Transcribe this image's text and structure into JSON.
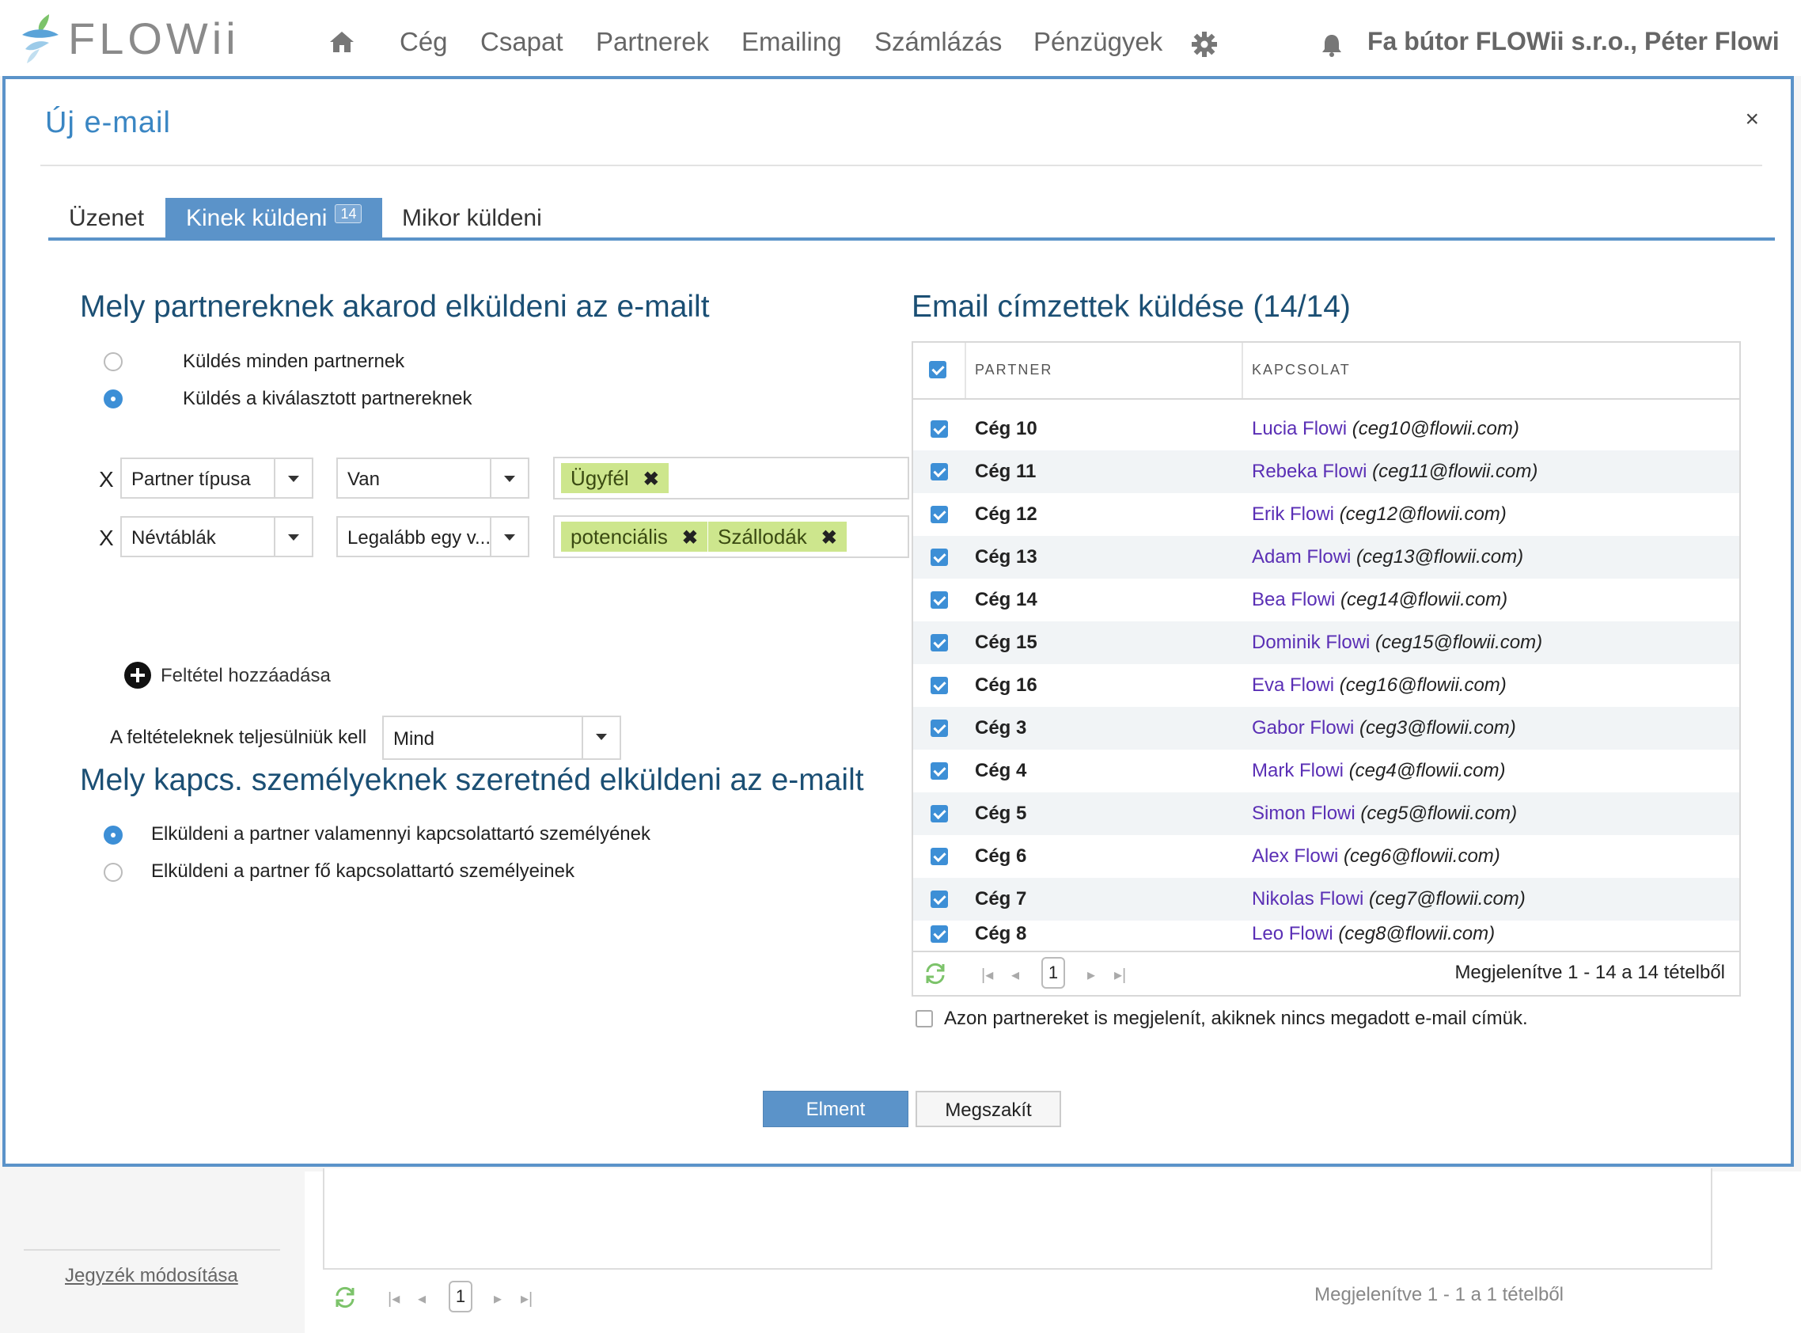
{
  "app": {
    "logo_text": "FLOWii"
  },
  "nav": {
    "items": [
      "Cég",
      "Csapat",
      "Partnerek",
      "Emailing",
      "Számlázás",
      "Pénzügyek"
    ],
    "user": "Fa bútor FLOWii s.r.o., Péter Flowi"
  },
  "modal": {
    "title": "Új e-mail",
    "close": "×",
    "tabs": [
      {
        "label": "Üzenet"
      },
      {
        "label": "Kinek küldeni",
        "badge": "14"
      },
      {
        "label": "Mikor küldeni"
      }
    ]
  },
  "partners_section": {
    "title": "Mely partnereknek akarod elküldeni az e-mailt",
    "options": [
      "Küldés minden partnernek",
      "Küldés a kiválasztott partnereknek"
    ],
    "selected_option": 1,
    "conditions": [
      {
        "remove": "X",
        "field": "Partner típusa",
        "operator": "Van",
        "values": [
          "Ügyfél"
        ]
      },
      {
        "remove": "X",
        "field": "Névtáblák",
        "operator": "Legalább egy v...",
        "values": [
          "potenciális",
          "Szállodák"
        ]
      }
    ],
    "add_condition": "Feltétel hozzáadása",
    "requirement_label": "A feltételeknek teljesülniük kell",
    "requirement_value": "Mind"
  },
  "contacts_section": {
    "title": "Mely kapcs. személyeknek szeretnéd elküldeni az e-mailt",
    "options": [
      "Elküldeni a partner valamennyi kapcsolattartó személyének",
      "Elküldeni a partner fő kapcsolattartó személyeinek"
    ],
    "selected_option": 0
  },
  "recipients": {
    "title": "Email címzettek küldése (14/14)",
    "columns": [
      "PARTNER",
      "KAPCSOLAT"
    ],
    "rows": [
      {
        "partner": "Cég 10",
        "contact": "Lucia Flowi",
        "email": "(ceg10@flowii.com)"
      },
      {
        "partner": "Cég 11",
        "contact": "Rebeka Flowi",
        "email": "(ceg11@flowii.com)"
      },
      {
        "partner": "Cég 12",
        "contact": "Erik Flowi",
        "email": "(ceg12@flowii.com)"
      },
      {
        "partner": "Cég 13",
        "contact": "Adam Flowi",
        "email": "(ceg13@flowii.com)"
      },
      {
        "partner": "Cég 14",
        "contact": "Bea Flowi",
        "email": "(ceg14@flowii.com)"
      },
      {
        "partner": "Cég 15",
        "contact": "Dominik Flowi",
        "email": "(ceg15@flowii.com)"
      },
      {
        "partner": "Cég 16",
        "contact": "Eva Flowi",
        "email": "(ceg16@flowii.com)"
      },
      {
        "partner": "Cég 3",
        "contact": "Gabor Flowi",
        "email": "(ceg3@flowii.com)"
      },
      {
        "partner": "Cég 4",
        "contact": "Mark Flowi",
        "email": "(ceg4@flowii.com)"
      },
      {
        "partner": "Cég 5",
        "contact": "Simon Flowi",
        "email": "(ceg5@flowii.com)"
      },
      {
        "partner": "Cég 6",
        "contact": "Alex Flowi",
        "email": "(ceg6@flowii.com)"
      },
      {
        "partner": "Cég 7",
        "contact": "Nikolas Flowi",
        "email": "(ceg7@flowii.com)"
      },
      {
        "partner": "Cég 8",
        "contact": "Leo Flowi",
        "email": "(ceg8@flowii.com)"
      }
    ],
    "pager": {
      "page": "1",
      "info": "Megjelenítve 1 - 14 a 14 tételből"
    },
    "no_email_option": "Azon partnereket is megjelenít, akiknek nincs megadott e-mail címük."
  },
  "actions": {
    "save": "Elment",
    "cancel": "Megszakít"
  },
  "background": {
    "link": "Jegyzék módosítása",
    "pager": {
      "page": "1",
      "info": "Megjelenítve 1 - 1 a 1 tételből"
    }
  },
  "colors": {
    "accent": "#5b93c9",
    "tag": "#cde68d",
    "title": "#1b4f74",
    "link": "#5a2fb5"
  },
  "icons": [
    "logo-leaf-icon",
    "home-icon",
    "gear-icon",
    "bell-icon",
    "close-icon",
    "chevron-down-icon",
    "plus-circle-icon",
    "refresh-icon",
    "first-page-icon",
    "prev-page-icon",
    "next-page-icon",
    "last-page-icon",
    "checkbox-icon"
  ]
}
